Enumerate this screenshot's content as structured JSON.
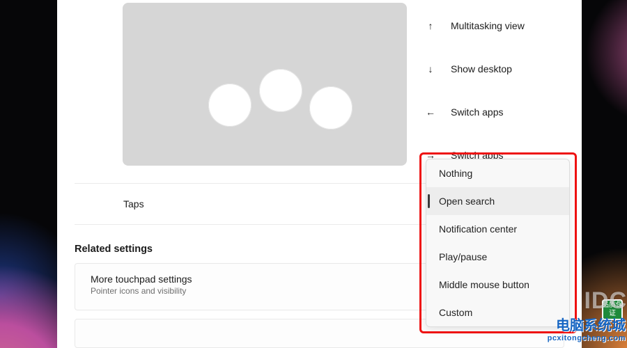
{
  "gestures": [
    {
      "icon": "↑",
      "label": "Multitasking view"
    },
    {
      "icon": "↓",
      "label": "Show desktop"
    },
    {
      "icon": "←",
      "label": "Switch apps"
    },
    {
      "icon": "→",
      "label": "Switch apps"
    }
  ],
  "taps": {
    "label": "Taps"
  },
  "related": {
    "heading": "Related settings"
  },
  "more_settings": {
    "title": "More touchpad settings",
    "subtitle": "Pointer icons and visibility"
  },
  "dropdown": {
    "options": [
      "Nothing",
      "Open search",
      "Notification center",
      "Play/pause",
      "Middle mouse button",
      "Custom"
    ],
    "selected_index": 1
  },
  "watermark": {
    "logo_text": "IDC",
    "badge_text": "品质保证",
    "site_cn": "电脑系统城",
    "site_url": "pcxitongcheng.com"
  }
}
